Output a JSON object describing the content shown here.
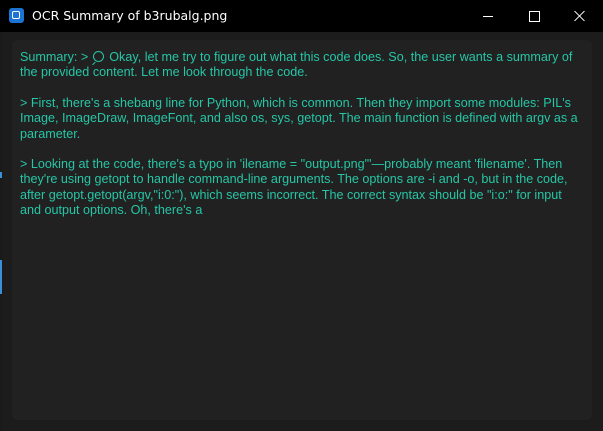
{
  "window": {
    "title": "OCR Summary of b3rubalg.png",
    "controls": {
      "minimize": "minimize",
      "maximize": "maximize",
      "close": "close"
    }
  },
  "summary": {
    "prefix": "Summary: > ",
    "icon": "search-icon",
    "paragraph1_rest": " Okay, let me try to figure out what this code does. So, the user wants a summary of the provided content. Let me look through the code.",
    "paragraph2": "> First, there's a shebang line for Python, which is common. Then they import some modules: PIL's Image, ImageDraw, ImageFont, and also os, sys, getopt. The main function is defined with argv as a parameter.",
    "paragraph3": "> Looking at the code, there's a typo in 'ilename = \"output.png\"'—probably meant 'filename'. Then they're using getopt to handle command-line arguments. The options are -i and -o, but in the code, after getopt.getopt(argv,\"i:0:\"), which seems incorrect. The correct syntax should be \"i:o:\" for input and output options. Oh, there's a"
  },
  "colors": {
    "titlebar": "#000000",
    "panel": "#212121",
    "text": "#26c6a6"
  }
}
